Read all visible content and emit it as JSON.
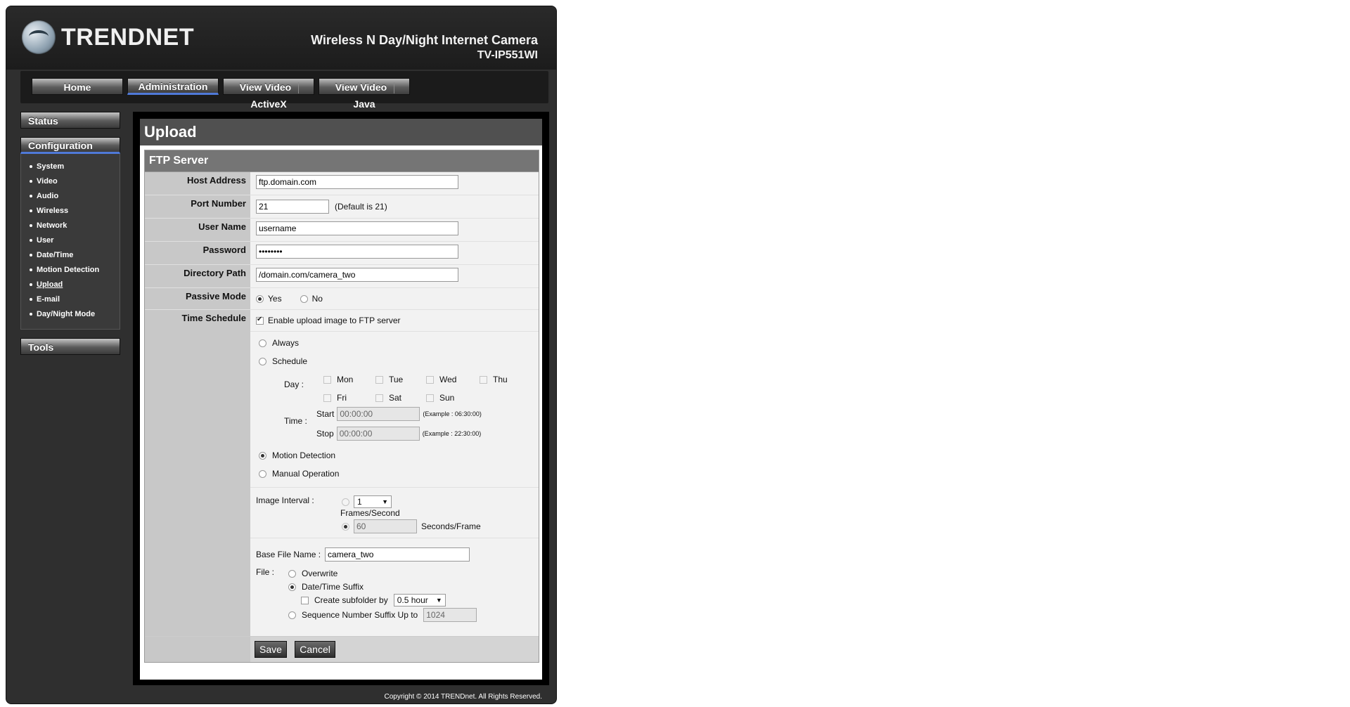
{
  "brand": {
    "logo_text": "TRENDNET",
    "product_line1": "Wireless N Day/Night Internet Camera",
    "product_line2": "TV-IP551WI"
  },
  "topnav": [
    {
      "label": "Home"
    },
    {
      "label": "Administration"
    },
    {
      "label": "View Video",
      "label2": "ActiveX"
    },
    {
      "label": "View Video",
      "label2": "Java"
    }
  ],
  "sidebar": {
    "status": "Status",
    "configuration": "Configuration",
    "items": [
      "System",
      "Video",
      "Audio",
      "Wireless",
      "Network",
      "User",
      "Date/Time",
      "Motion Detection",
      "Upload",
      "E-mail",
      "Day/Night Mode"
    ],
    "tools": "Tools"
  },
  "page": {
    "title": "Upload",
    "section": "FTP Server"
  },
  "form": {
    "host_address": {
      "label": "Host Address",
      "value": "ftp.domain.com"
    },
    "port_number": {
      "label": "Port Number",
      "value": "21",
      "hint": "(Default is 21)"
    },
    "user_name": {
      "label": "User Name",
      "value": "username"
    },
    "password": {
      "label": "Password",
      "value": "••••••••"
    },
    "directory_path": {
      "label": "Directory Path",
      "value": "/domain.com/camera_two"
    },
    "passive_mode": {
      "label": "Passive Mode",
      "yes": "Yes",
      "no": "No"
    },
    "time_schedule": {
      "label": "Time Schedule",
      "enable": "Enable upload image to FTP server",
      "always": "Always",
      "schedule": "Schedule",
      "day_label": "Day :",
      "days": [
        "Mon",
        "Tue",
        "Wed",
        "Thu",
        "Fri",
        "Sat",
        "Sun"
      ],
      "time_label": "Time :",
      "start_label": "Start",
      "start_value": "00:00:00",
      "start_example": "(Example : 06:30:00)",
      "stop_label": "Stop",
      "stop_value": "00:00:00",
      "stop_example": "(Example : 22:30:00)",
      "motion": "Motion Detection",
      "manual": "Manual Operation"
    },
    "image_interval": {
      "label": "Image Interval :",
      "fps_value": "1",
      "fps_unit": "Frames/Second",
      "spf_value": "60",
      "spf_unit": "Seconds/Frame"
    },
    "base_file": {
      "label": "Base File Name :",
      "value": "camera_two"
    },
    "file": {
      "label": "File :",
      "overwrite": "Overwrite",
      "datetime": "Date/Time Suffix",
      "subfolder": "Create subfolder by",
      "subfolder_value": "0.5 hour",
      "sequence": "Sequence Number Suffix Up to",
      "sequence_value": "1024"
    },
    "buttons": {
      "save": "Save",
      "cancel": "Cancel"
    }
  },
  "footer": {
    "copyright": "Copyright © 2014 TRENDnet.   All Rights Reserved."
  }
}
